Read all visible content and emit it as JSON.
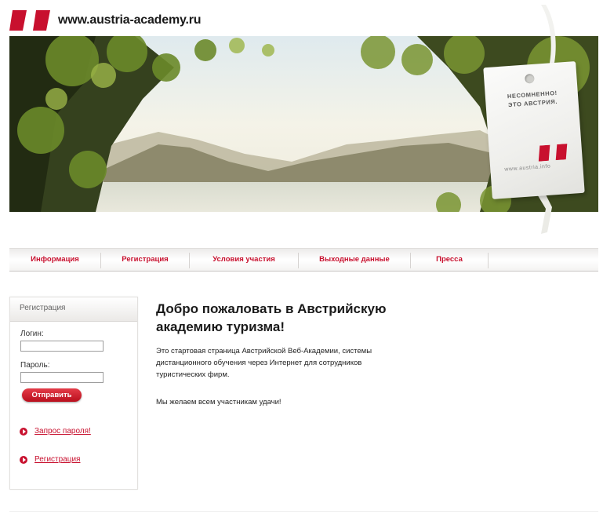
{
  "header": {
    "site_url": "www.austria-academy.ru",
    "logo_icon": "austria-flag-logo-icon",
    "brand_color": "#c8102e"
  },
  "banner": {
    "tag_line1": "НЕСОМНЕННО!",
    "tag_line2": "ЭТО АВСТРИЯ.",
    "tag_url": "www.austria.info"
  },
  "nav": {
    "items": [
      {
        "label": "Информация"
      },
      {
        "label": "Регистрация"
      },
      {
        "label": "Условия участия"
      },
      {
        "label": "Выходные данные"
      },
      {
        "label": "Пресса"
      }
    ]
  },
  "login": {
    "title": "Регистрация",
    "login_label": "Логин:",
    "login_value": "",
    "password_label": "Пароль:",
    "password_value": "",
    "submit_label": "Отправить",
    "links": [
      {
        "label": "Запрос пароля!",
        "icon": "arrow-bullet-icon"
      },
      {
        "label": "Регистрация",
        "icon": "arrow-bullet-icon"
      }
    ]
  },
  "main": {
    "heading_line1": "Добро пожаловать в Австрийскую",
    "heading_line2": "академию туризма!",
    "paragraph1_line1": "Это стартовая страница Австрийской Веб-Академии, системы",
    "paragraph1_line2": "дистанционного обучения через Интернет для сотрудников",
    "paragraph1_line3": "туристических фирм.",
    "paragraph2": "Мы желаем всем участникам удачи!"
  }
}
